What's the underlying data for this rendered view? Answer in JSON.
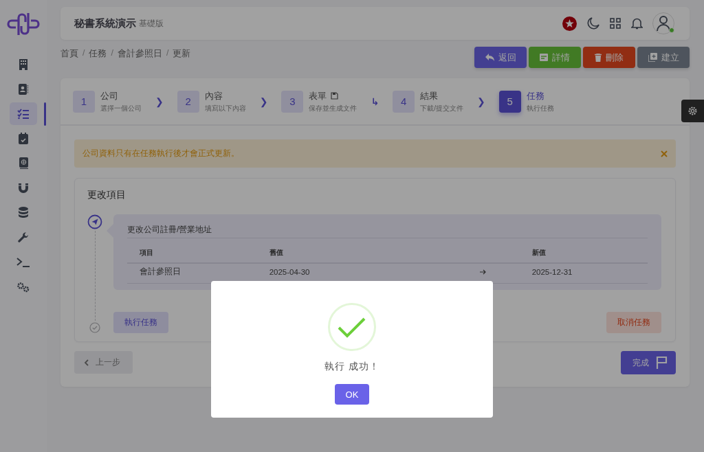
{
  "header": {
    "title": "秘書系統演示",
    "edition": "基礎版"
  },
  "sidebar": {
    "items": [
      {
        "selected": false
      },
      {
        "selected": false
      },
      {
        "selected": true
      },
      {
        "selected": false
      },
      {
        "selected": false
      },
      {
        "selected": false
      },
      {
        "selected": false
      },
      {
        "selected": false
      },
      {
        "selected": false
      },
      {
        "selected": false
      }
    ]
  },
  "breadcrumb": {
    "separator": "/",
    "items": [
      "首頁",
      "任務",
      "會計參照日",
      "更新"
    ]
  },
  "actions": [
    {
      "label": "返回",
      "kind": "back"
    },
    {
      "label": "詳情",
      "kind": "details"
    },
    {
      "label": "刪除",
      "kind": "delete"
    },
    {
      "label": "建立",
      "kind": "create"
    }
  ],
  "steps": [
    {
      "number": "1",
      "title": "公司",
      "subtitle": "選擇一個公司",
      "selected": false,
      "kind": "plain",
      "connector": "❯"
    },
    {
      "number": "2",
      "title": "內容",
      "subtitle": "填寫以下內容",
      "selected": false,
      "kind": "plain",
      "connector": "❯"
    },
    {
      "number": "3",
      "title": "表單",
      "subtitle": "保存並生成文件",
      "selected": false,
      "kind": "save",
      "connector": "↳"
    },
    {
      "number": "4",
      "title": "結果",
      "subtitle": "下載/提交文件",
      "selected": false,
      "kind": "plain",
      "connector": "❯"
    },
    {
      "number": "5",
      "title": "任務",
      "subtitle": "執行任務",
      "selected": true,
      "kind": "plain"
    }
  ],
  "alert": {
    "text": "公司資料只有在任務執行後才會正式更新。"
  },
  "changes": {
    "title": "更改項目",
    "item_title": "更改公司註冊/營業地址",
    "columns": [
      "項目",
      "舊值",
      "新值"
    ],
    "rows": [
      {
        "item": "會計參照日",
        "old": "2025-04-30",
        "new": "2025-12-31"
      }
    ],
    "execute_button": "執行任務",
    "cancel_button": "取消任務"
  },
  "nav": {
    "previous": "上一步",
    "finish": "完成"
  },
  "modal": {
    "message": "執行 成功！",
    "ok": "OK"
  }
}
